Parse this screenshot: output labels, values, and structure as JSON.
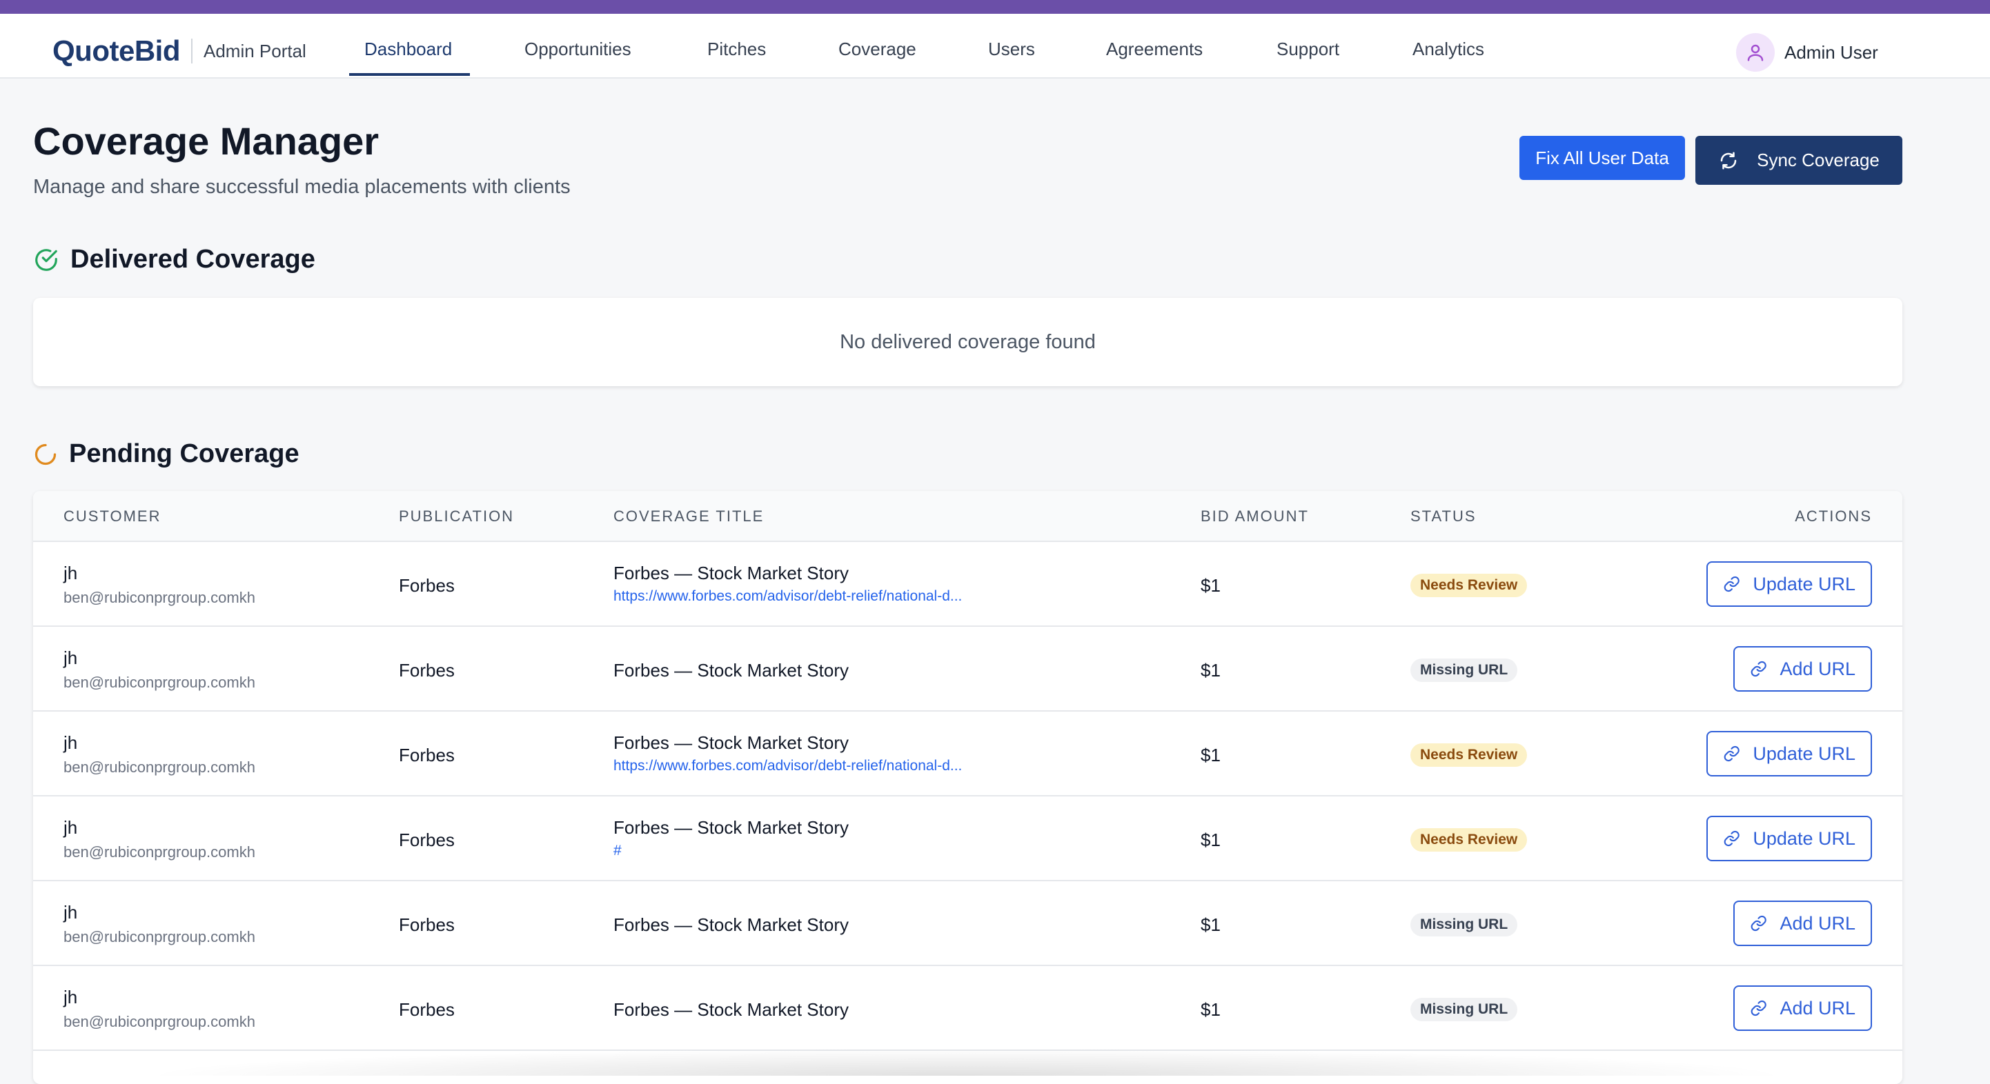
{
  "header": {
    "logo": "QuoteBid",
    "portal_label": "Admin Portal",
    "nav": [
      "Dashboard",
      "Opportunities",
      "Pitches",
      "Coverage",
      "Users",
      "Agreements",
      "Support",
      "Analytics"
    ],
    "active_nav": "Dashboard",
    "user_name": "Admin User"
  },
  "page": {
    "title": "Coverage Manager",
    "subtitle": "Manage and share successful media placements with clients",
    "fix_button": "Fix All User Data",
    "sync_button": "Sync Coverage"
  },
  "delivered": {
    "title": "Delivered Coverage",
    "empty_message": "No delivered coverage found"
  },
  "pending": {
    "title": "Pending Coverage",
    "columns": [
      "CUSTOMER",
      "PUBLICATION",
      "COVERAGE TITLE",
      "BID AMOUNT",
      "STATUS",
      "ACTIONS"
    ],
    "rows": [
      {
        "name": "jh",
        "email": "ben@rubiconprgroup.comkh",
        "publication": "Forbes",
        "title": "Forbes — Stock Market Story",
        "url": "https://www.forbes.com/advisor/debt-relief/national-d...",
        "bid": "$1",
        "status": "Needs Review",
        "action": "Update URL"
      },
      {
        "name": "jh",
        "email": "ben@rubiconprgroup.comkh",
        "publication": "Forbes",
        "title": "Forbes — Stock Market Story",
        "url": "",
        "bid": "$1",
        "status": "Missing URL",
        "action": "Add URL"
      },
      {
        "name": "jh",
        "email": "ben@rubiconprgroup.comkh",
        "publication": "Forbes",
        "title": "Forbes — Stock Market Story",
        "url": "https://www.forbes.com/advisor/debt-relief/national-d...",
        "bid": "$1",
        "status": "Needs Review",
        "action": "Update URL"
      },
      {
        "name": "jh",
        "email": "ben@rubiconprgroup.comkh",
        "publication": "Forbes",
        "title": "Forbes — Stock Market Story",
        "url": "#",
        "bid": "$1",
        "status": "Needs Review",
        "action": "Update URL"
      },
      {
        "name": "jh",
        "email": "ben@rubiconprgroup.comkh",
        "publication": "Forbes",
        "title": "Forbes — Stock Market Story",
        "url": "",
        "bid": "$1",
        "status": "Missing URL",
        "action": "Add URL"
      },
      {
        "name": "jh",
        "email": "ben@rubiconprgroup.comkh",
        "publication": "Forbes",
        "title": "Forbes — Stock Market Story",
        "url": "",
        "bid": "$1",
        "status": "Missing URL",
        "action": "Add URL"
      }
    ]
  },
  "icons": {
    "delivered": "check-circle-icon",
    "pending": "loader-icon",
    "sync": "refresh-icon",
    "link": "link-icon",
    "user": "user-icon"
  },
  "colors": {
    "top_stripe": "#6b4fa8",
    "brand": "#1e3a6e",
    "primary_button": "#2563eb",
    "delivered_icon": "#22a55b",
    "pending_icon": "#e08a1e",
    "needs_review_bg": "#fcf1c6",
    "missing_url_bg": "#f0f1f3"
  }
}
